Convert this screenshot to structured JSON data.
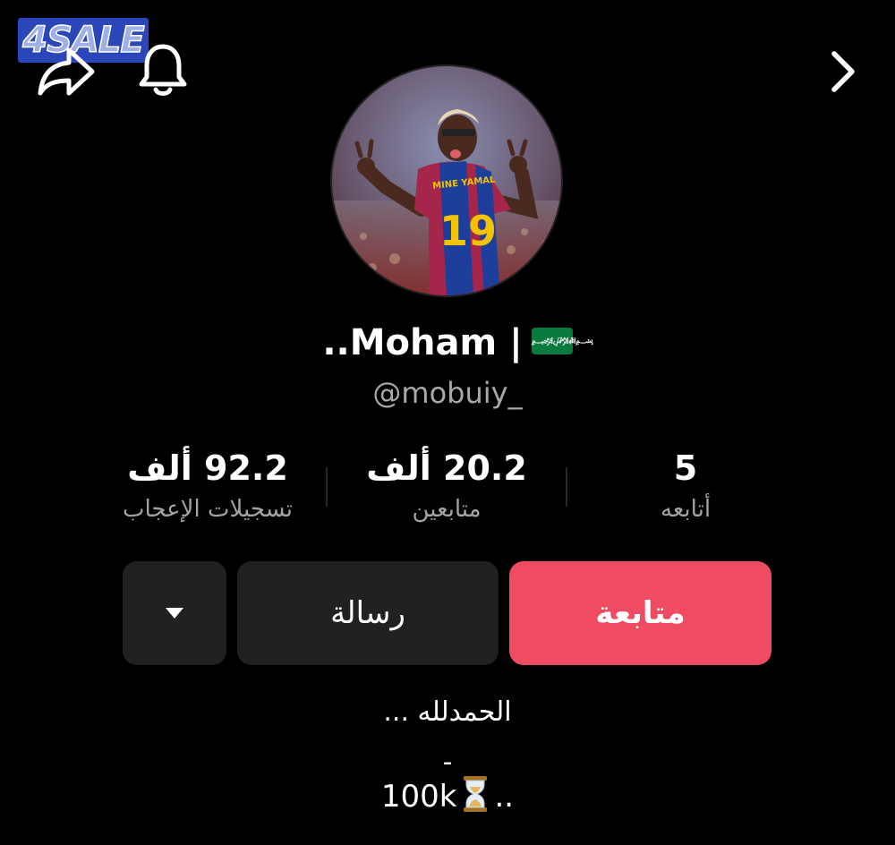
{
  "watermark": {
    "text": "4SALE"
  },
  "header": {
    "share_icon": "share-arrow-icon",
    "bell_icon": "bell-icon",
    "back_icon": "chevron-right-icon"
  },
  "profile": {
    "display_name": "..Moham |",
    "flag_icon": "saudi-flag-icon",
    "username": "@mobuiy_"
  },
  "stats": [
    {
      "value": "5",
      "label": "أتابعه"
    },
    {
      "value": "20.2 ألف",
      "label": "متابعين"
    },
    {
      "value": "92.2 ألف",
      "label": "تسجيلات الإعجاب"
    }
  ],
  "actions": {
    "follow_label": "متابعة",
    "message_label": "رسالة",
    "more_icon": "caret-down-icon"
  },
  "bio": {
    "line1": "الحمدلله ...",
    "line2": "-",
    "line3_before": "100k",
    "line3_after": ".."
  },
  "colors": {
    "background": "#000000",
    "follow_button": "#ef4c63",
    "secondary_button": "#212121",
    "muted_text": "#a3a3a3"
  }
}
